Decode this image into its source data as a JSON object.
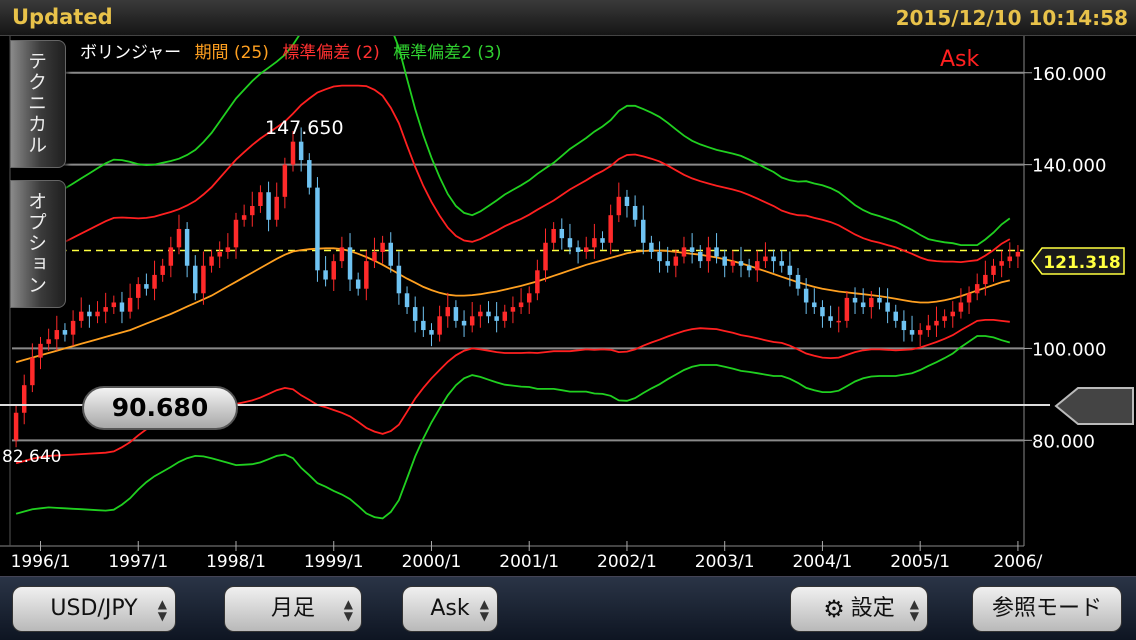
{
  "header": {
    "status": "Updated",
    "timestamp": "2015/12/10 10:14:58"
  },
  "legend": {
    "name": "ボリンジャー",
    "period": "期間 (25)",
    "sd1": "標準偏差 (2)",
    "sd2": "標準偏差2 (3)"
  },
  "side_tabs": {
    "technical": "テクニカル",
    "option": "オプション"
  },
  "price_type_label": "Ask",
  "current_price": "121.318",
  "crosshair_price": "90.680",
  "high_label": "147.650",
  "low_label": "82.640",
  "toolbar": {
    "pair": "USD/JPY",
    "period": "月足",
    "price_type": "Ask",
    "settings": "設定",
    "reference_mode": "参照モード"
  },
  "colors": {
    "accent": "#e8c24a",
    "up_candle": "#ff2a2a",
    "down_candle": "#6fc3f2",
    "middle_band": "#ffa020",
    "band_2sd": "#ff2020",
    "band_3sd": "#20d020",
    "current_price_line": "#ffff40"
  },
  "icons": {
    "settings": "gear-icon",
    "selector": "up-down-arrows-icon"
  },
  "chart_data": {
    "type": "candlestick",
    "y_ticks": [
      "160.000",
      "140.000",
      "100.000",
      "80.000"
    ],
    "y_tick_values": [
      160,
      140,
      100,
      80
    ],
    "ylim": [
      57,
      168
    ],
    "x_ticks": [
      "1996/1",
      "1997/1",
      "1998/1",
      "1999/1",
      "2000/1",
      "2001/1",
      "2002/1",
      "2003/1",
      "2004/1",
      "2005/1",
      "2006/"
    ],
    "x_tick_index": [
      3,
      15,
      27,
      39,
      51,
      63,
      75,
      87,
      99,
      111,
      123
    ],
    "current_price": 121.318,
    "crosshair_price": 90.68,
    "close": [
      86.0,
      92.0,
      98.0,
      101.0,
      102.0,
      104.0,
      103.0,
      106.0,
      108.0,
      107.0,
      108.0,
      109.0,
      110.0,
      108.0,
      111.0,
      114.0,
      113.0,
      116.0,
      118.0,
      122.0,
      126.0,
      118.0,
      112.0,
      118.0,
      120.0,
      121.0,
      122.0,
      128.0,
      129.0,
      131.0,
      134.0,
      128.0,
      133.0,
      140.0,
      145.0,
      141.0,
      135.0,
      117.0,
      115.0,
      119.0,
      122.0,
      115.0,
      113.0,
      119.0,
      121.0,
      123.0,
      118.0,
      112.0,
      109.0,
      106.0,
      104.0,
      103.0,
      107.0,
      109.0,
      106.0,
      105.0,
      107.0,
      108.0,
      107.0,
      106.0,
      108.0,
      109.0,
      110.0,
      112.0,
      117.0,
      123.0,
      126.0,
      124.0,
      122.0,
      121.0,
      122.0,
      124.0,
      123.0,
      129.0,
      133.0,
      131.0,
      128.0,
      123.0,
      121.0,
      119.0,
      118.0,
      120.0,
      122.0,
      121.0,
      119.0,
      122.0,
      120.0,
      118.0,
      119.0,
      118.0,
      117.0,
      119.0,
      120.0,
      119.0,
      118.0,
      116.0,
      113.0,
      110.0,
      109.0,
      107.0,
      106.0,
      106.0,
      111.0,
      110.0,
      109.0,
      111.0,
      110.0,
      108.0,
      106.0,
      104.0,
      103.0,
      104.0,
      105.0,
      106.0,
      107.0,
      108.0,
      110.0,
      112.0,
      114.0,
      116.0,
      118.0,
      119.0,
      120.0,
      121.0
    ],
    "middle_band": [
      97.0,
      97.5,
      98.0,
      98.5,
      99.0,
      99.5,
      100.0,
      100.5,
      101.0,
      101.5,
      102.0,
      102.5,
      103.0,
      103.5,
      104.0,
      104.7,
      105.4,
      106.1,
      106.8,
      107.5,
      108.3,
      109.1,
      109.9,
      110.7,
      111.5,
      112.5,
      113.5,
      114.5,
      115.5,
      116.5,
      117.5,
      118.5,
      119.5,
      120.4,
      121.1,
      121.4,
      121.6,
      121.7,
      121.8,
      121.8,
      121.6,
      121.2,
      120.6,
      119.9,
      119.1,
      118.2,
      117.2,
      116.2,
      115.2,
      114.3,
      113.4,
      112.7,
      112.1,
      111.7,
      111.5,
      111.5,
      111.6,
      111.8,
      112.1,
      112.4,
      112.8,
      113.2,
      113.6,
      114.1,
      114.6,
      115.2,
      115.8,
      116.4,
      117.0,
      117.6,
      118.2,
      118.7,
      119.2,
      119.7,
      120.2,
      120.7,
      121.0,
      121.2,
      121.3,
      121.3,
      121.2,
      121.0,
      120.8,
      120.6,
      120.4,
      120.1,
      119.8,
      119.4,
      119.0,
      118.5,
      118.0,
      117.4,
      116.8,
      116.2,
      115.6,
      115.0,
      114.4,
      113.9,
      113.4,
      113.0,
      112.7,
      112.4,
      112.2,
      112.0,
      111.8,
      111.6,
      111.4,
      111.1,
      110.8,
      110.5,
      110.2,
      110.0,
      110.0,
      110.2,
      110.5,
      110.9,
      111.4,
      112.0,
      112.6,
      113.2,
      113.8,
      114.4,
      114.8
    ],
    "sd": [
      11.0,
      11.0,
      11.0,
      11.1,
      11.2,
      11.4,
      11.6,
      11.8,
      12.0,
      12.2,
      12.4,
      12.6,
      12.7,
      12.5,
      12.2,
      11.8,
      11.5,
      11.3,
      11.2,
      11.1,
      11.0,
      11.0,
      11.1,
      11.4,
      11.8,
      12.3,
      12.8,
      13.3,
      13.6,
      13.9,
      14.1,
      14.2,
      14.3,
      14.5,
      15.0,
      15.8,
      16.4,
      17.0,
      17.3,
      17.6,
      17.8,
      18.0,
      18.3,
      18.6,
      18.6,
      18.4,
      17.6,
      16.4,
      14.5,
      12.6,
      11.0,
      9.6,
      8.4,
      7.3,
      6.5,
      6.0,
      5.8,
      6.0,
      6.3,
      6.6,
      6.9,
      7.1,
      7.3,
      7.5,
      7.8,
      8.0,
      8.2,
      8.5,
      8.8,
      9.0,
      9.2,
      9.5,
      9.7,
      10.0,
      10.5,
      10.7,
      10.6,
      10.3,
      10.0,
      9.7,
      9.3,
      8.9,
      8.5,
      8.2,
      8.0,
      7.9,
      7.8,
      7.8,
      7.8,
      7.8,
      7.7,
      7.6,
      7.5,
      7.4,
      7.2,
      7.2,
      7.3,
      7.5,
      7.5,
      7.5,
      7.4,
      7.2,
      6.8,
      6.4,
      6.1,
      5.9,
      5.8,
      5.7,
      5.6,
      5.4,
      5.2,
      4.9,
      4.6,
      4.4,
      4.2,
      4.0,
      3.7,
      3.5,
      3.3,
      3.5,
      3.8,
      4.2,
      4.5
    ]
  }
}
